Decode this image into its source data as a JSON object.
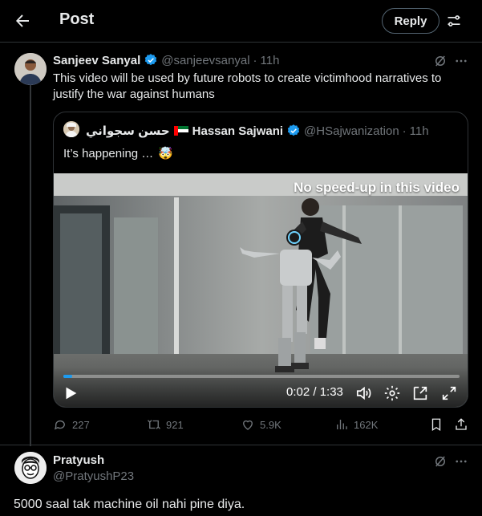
{
  "header": {
    "title": "Post",
    "reply_label": "Reply"
  },
  "post": {
    "author_name": "Sanjeev Sanyal",
    "handle": "@sanjeevsanyal",
    "dot": "·",
    "time": "11h",
    "text": "This video will be used by future robots to create victimhood narratives to justify the war against humans",
    "quote": {
      "arabic_name": "حسن سجواني",
      "author_name": "Hassan Sajwani",
      "handle": "@HSajwanization",
      "dot": "·",
      "time": "11h",
      "text": "It’s happening …",
      "emoji": "🤯",
      "video": {
        "overlay_text": "No speed-up in this video",
        "time_display": "0:02 / 1:33",
        "progress": 0.0215
      }
    },
    "stats": {
      "replies": "227",
      "reposts": "921",
      "likes": "5.9K",
      "views": "162K"
    }
  },
  "reply": {
    "author_name": "Pratyush",
    "handle": "@PratyushP23",
    "text": "5000 saal tak machine oil nahi pine diya."
  },
  "colors": {
    "accent": "#1d9bf0",
    "verified": "#1d9bf0",
    "muted": "#71767b",
    "border": "#2f3336"
  }
}
